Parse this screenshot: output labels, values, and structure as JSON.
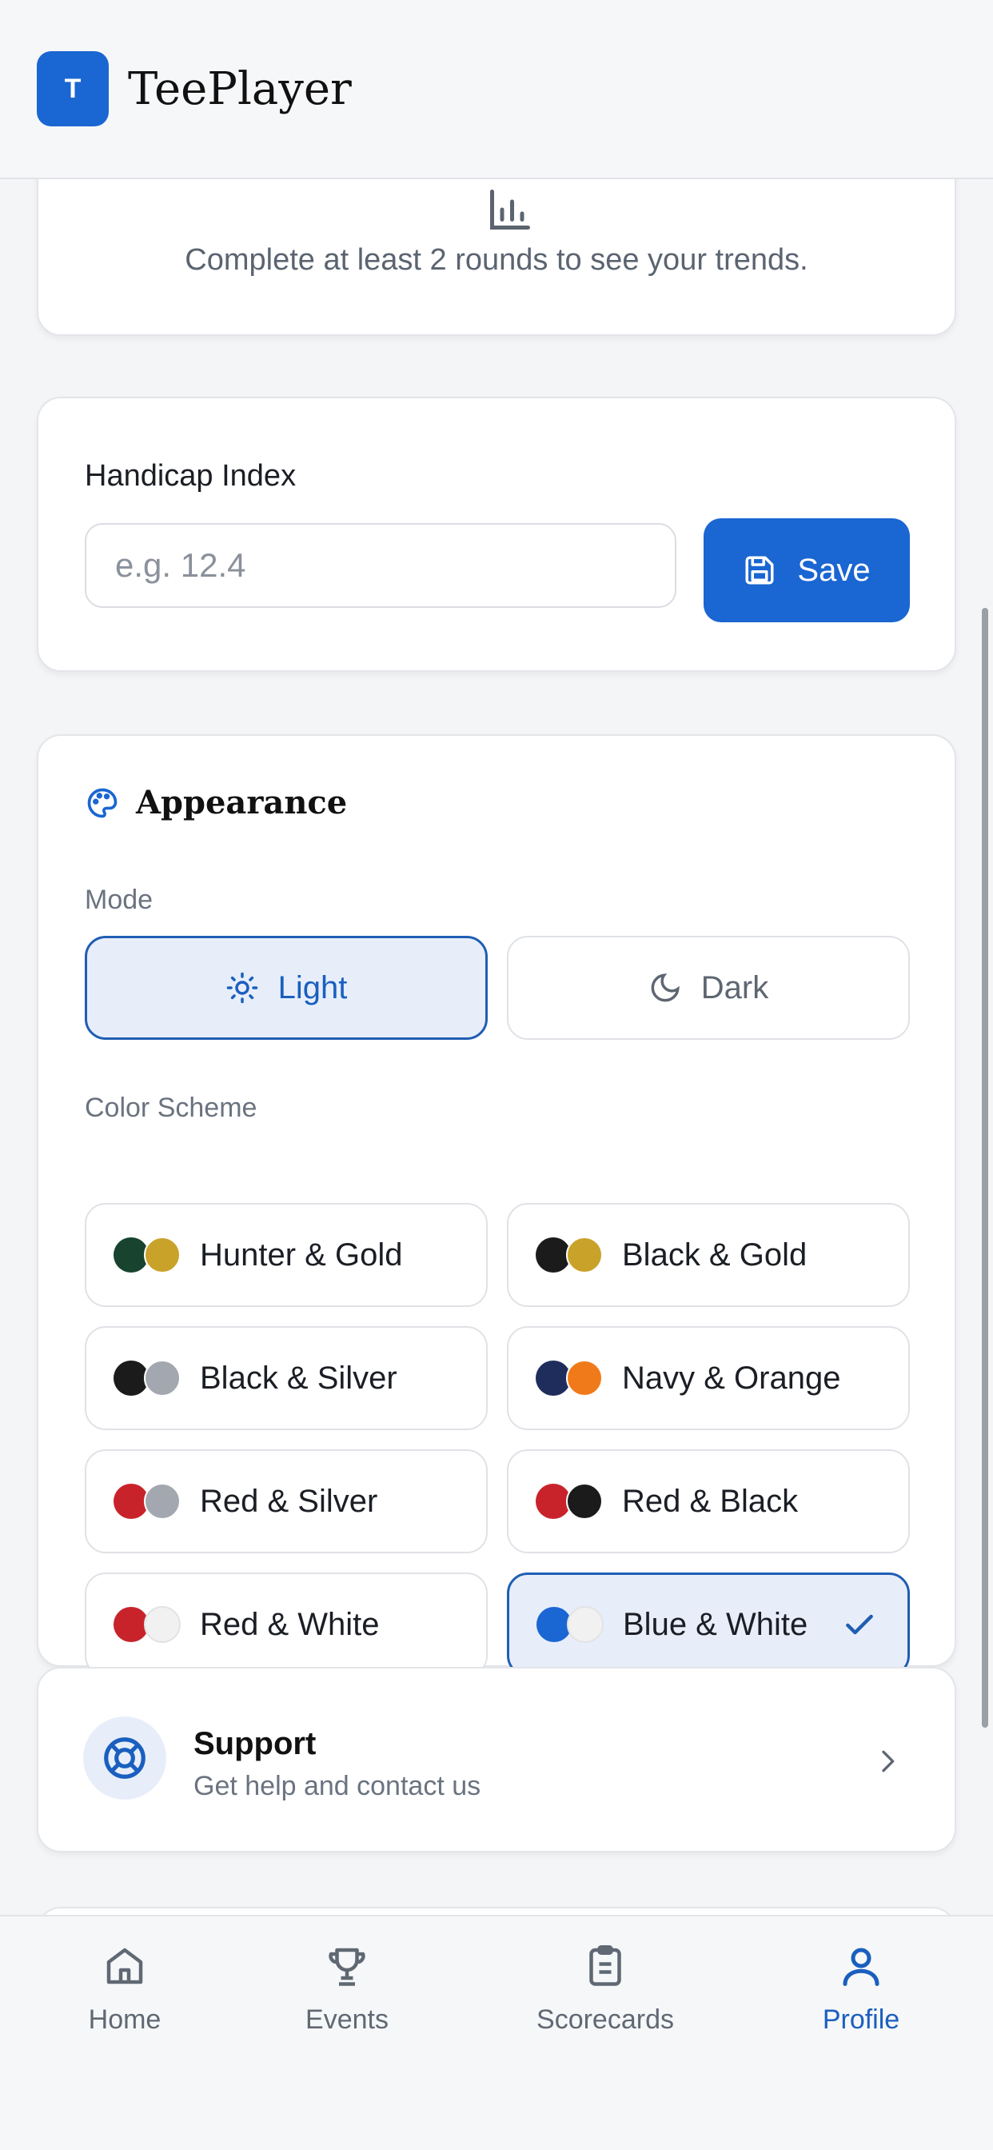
{
  "app": {
    "logo_letter": "T",
    "title": "TeePlayer"
  },
  "trends": {
    "message": "Complete at least 2 rounds to see your trends."
  },
  "handicap": {
    "label": "Handicap Index",
    "placeholder": "e.g. 12.4",
    "value": "",
    "save_label": "Save"
  },
  "appearance": {
    "title": "Appearance",
    "mode_label": "Mode",
    "modes": [
      {
        "label": "Light",
        "selected": true
      },
      {
        "label": "Dark",
        "selected": false
      }
    ],
    "scheme_label": "Color Scheme",
    "schemes": [
      {
        "name": "Hunter & Gold",
        "colors": [
          "#17432f",
          "#c9a22a"
        ],
        "selected": false
      },
      {
        "name": "Black & Gold",
        "colors": [
          "#1b1b1b",
          "#c9a22a"
        ],
        "selected": false
      },
      {
        "name": "Black & Silver",
        "colors": [
          "#1b1b1b",
          "#a3a8b0"
        ],
        "selected": false
      },
      {
        "name": "Navy & Orange",
        "colors": [
          "#1e2d5c",
          "#f07a1a"
        ],
        "selected": false
      },
      {
        "name": "Red & Silver",
        "colors": [
          "#c8232b",
          "#a3a8b0"
        ],
        "selected": false
      },
      {
        "name": "Red & Black",
        "colors": [
          "#c8232b",
          "#1b1b1b"
        ],
        "selected": false
      },
      {
        "name": "Red & White",
        "colors": [
          "#c8232b",
          "#f1f1f1"
        ],
        "selected": false
      },
      {
        "name": "Blue & White",
        "colors": [
          "#1a66d2",
          "#f1f1f1"
        ],
        "selected": true
      }
    ]
  },
  "support": {
    "title": "Support",
    "subtitle": "Get help and contact us"
  },
  "nav": [
    {
      "label": "Home",
      "icon": "home-icon",
      "active": false
    },
    {
      "label": "Events",
      "icon": "trophy-icon",
      "active": false
    },
    {
      "label": "Scorecards",
      "icon": "clipboard-icon",
      "active": false
    },
    {
      "label": "Profile",
      "icon": "user-icon",
      "active": true
    }
  ],
  "colors": {
    "accent": "#1a66d2",
    "selected_bg": "#e7eefa",
    "selected_border": "#1f5eb3"
  }
}
